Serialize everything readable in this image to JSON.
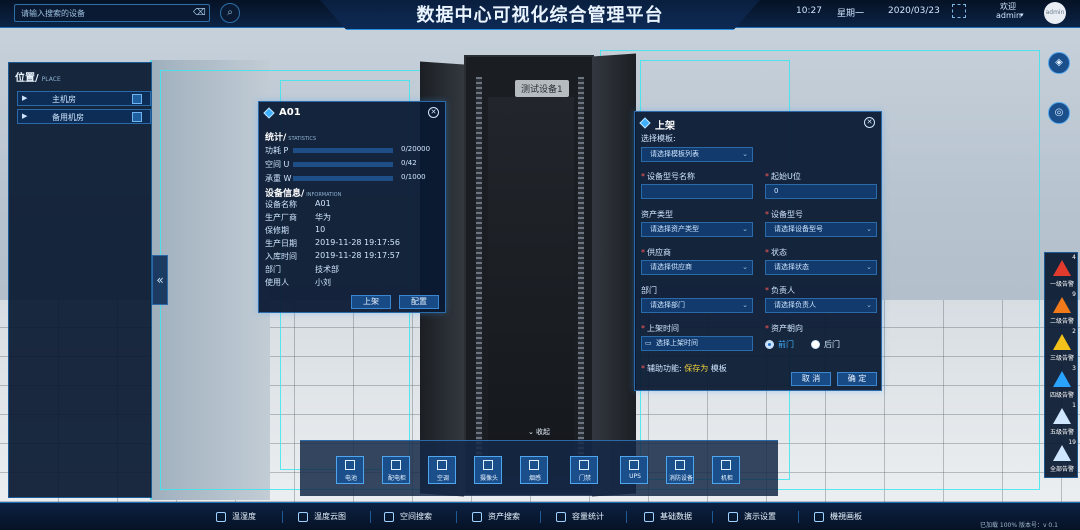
{
  "header": {
    "title": "数据中心可视化综合管理平台",
    "search_placeholder": "请输入搜索的设备",
    "time": "10:27",
    "weekday": "星期一",
    "date": "2020/03/23",
    "welcome": "欢迎",
    "user": "admin",
    "avatar_text": "admin"
  },
  "location": {
    "title": "位置/",
    "title_en": "PLACE",
    "items": [
      {
        "label": "主机房"
      },
      {
        "label": "备用机房"
      }
    ]
  },
  "scene": {
    "device_tag": "测试设备1"
  },
  "a01": {
    "title": "A01",
    "stats_title": "统计/",
    "stats_title_en": "STATISTICS",
    "stats": [
      {
        "key": "功耗 P",
        "value": "0/20000",
        "fraction": 0
      },
      {
        "key": "空间 U",
        "value": "0/42",
        "fraction": 0
      },
      {
        "key": "承重 W",
        "value": "0/1000",
        "fraction": 0
      }
    ],
    "info_title": "设备信息/",
    "info_title_en": "INFORMATION",
    "info": [
      {
        "key": "设备名称",
        "value": "A01"
      },
      {
        "key": "生产厂商",
        "value": "华为"
      },
      {
        "key": "保修期",
        "value": "10"
      },
      {
        "key": "生产日期",
        "value": "2019-11-28 19:17:56"
      },
      {
        "key": "入库时间",
        "value": "2019-11-28 19:17:57"
      },
      {
        "key": "部门",
        "value": "技术部"
      },
      {
        "key": "使用人",
        "value": "小刘"
      }
    ],
    "btn_shelf": "上架",
    "btn_config": "配置"
  },
  "shelf": {
    "title": "上架",
    "template_label": "选择模板:",
    "template_placeholder": "请选择模板列表",
    "model_name_label": "设备型号名称",
    "start_u_label": "起始U位",
    "start_u_value": "0",
    "asset_type_label": "资产类型",
    "asset_type_placeholder": "请选择资产类型",
    "device_model_label": "设备型号",
    "device_model_placeholder": "请选择设备型号",
    "supplier_label": "供应商",
    "supplier_placeholder": "请选择供应商",
    "status_label": "状态",
    "status_placeholder": "请选择状态",
    "dept_label": "部门",
    "dept_placeholder": "请选择部门",
    "owner_label": "负责人",
    "owner_placeholder": "请选择负责人",
    "shelf_time_label": "上架时间",
    "shelf_time_placeholder": "选择上架时间",
    "orientation_label": "资产朝向",
    "front": "前门",
    "back": "后门",
    "aux_label": "辅助功能:",
    "aux_save": "保存为",
    "aux_template": "模板",
    "cancel": "取 消",
    "confirm": "确 定"
  },
  "alarms": [
    {
      "label": "一级告警",
      "count": "4",
      "color": "#e23b2e"
    },
    {
      "label": "二级告警",
      "count": "9",
      "color": "#f27a1a"
    },
    {
      "label": "三级告警",
      "count": "2",
      "color": "#f2c21a"
    },
    {
      "label": "四级告警",
      "count": "3",
      "color": "#2aa3ff"
    },
    {
      "label": "五级告警",
      "count": "1",
      "color": "#cfe6ff"
    },
    {
      "label": "全部告警",
      "count": "19",
      "color": "#cfe6ff"
    }
  ],
  "dock": {
    "collapse": "收起",
    "items": [
      {
        "label": "电池"
      },
      {
        "label": "配电柜"
      },
      {
        "label": "空调"
      },
      {
        "label": "摄像头"
      },
      {
        "label": "烟感"
      },
      {
        "label": "门禁"
      },
      {
        "label": "UPS"
      },
      {
        "label": "消防设备"
      },
      {
        "label": "机柜"
      }
    ]
  },
  "nav": [
    {
      "label": "温湿度"
    },
    {
      "label": "温度云图"
    },
    {
      "label": "空间搜索"
    },
    {
      "label": "资产搜索"
    },
    {
      "label": "容量统计"
    },
    {
      "label": "基础数据"
    },
    {
      "label": "演示设置"
    },
    {
      "label": "機視画板"
    }
  ],
  "footer": {
    "version": "已加载 100% 版本号：v 0.1"
  }
}
